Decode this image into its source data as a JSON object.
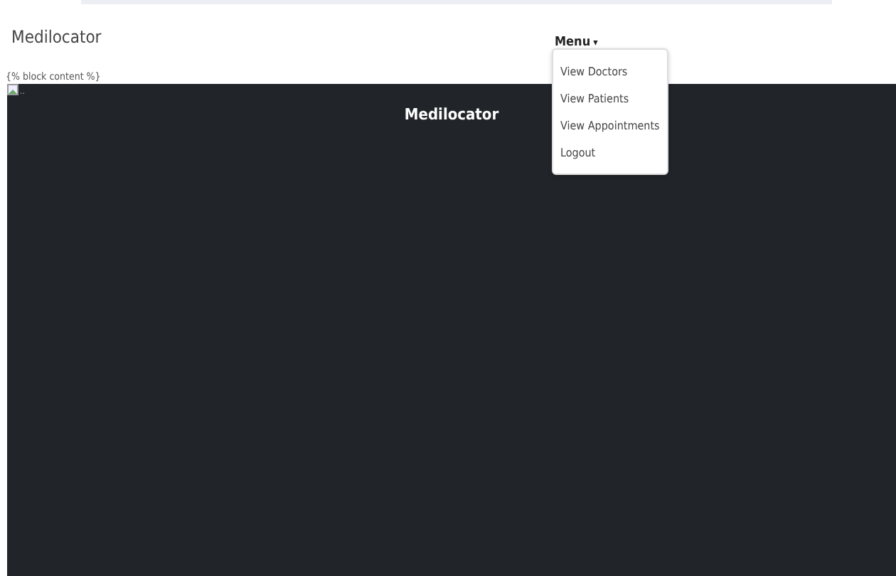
{
  "navbar": {
    "brand": "Medilocator",
    "menu": {
      "label": "Menu",
      "caret": "▾",
      "expanded": true,
      "items": [
        {
          "label": "View Doctors"
        },
        {
          "label": "View Patients"
        },
        {
          "label": "View Appointments"
        },
        {
          "label": "Logout"
        }
      ]
    }
  },
  "template_text": "{% block content %}",
  "hero": {
    "image_alt": "..",
    "title": "Medilocator"
  }
}
